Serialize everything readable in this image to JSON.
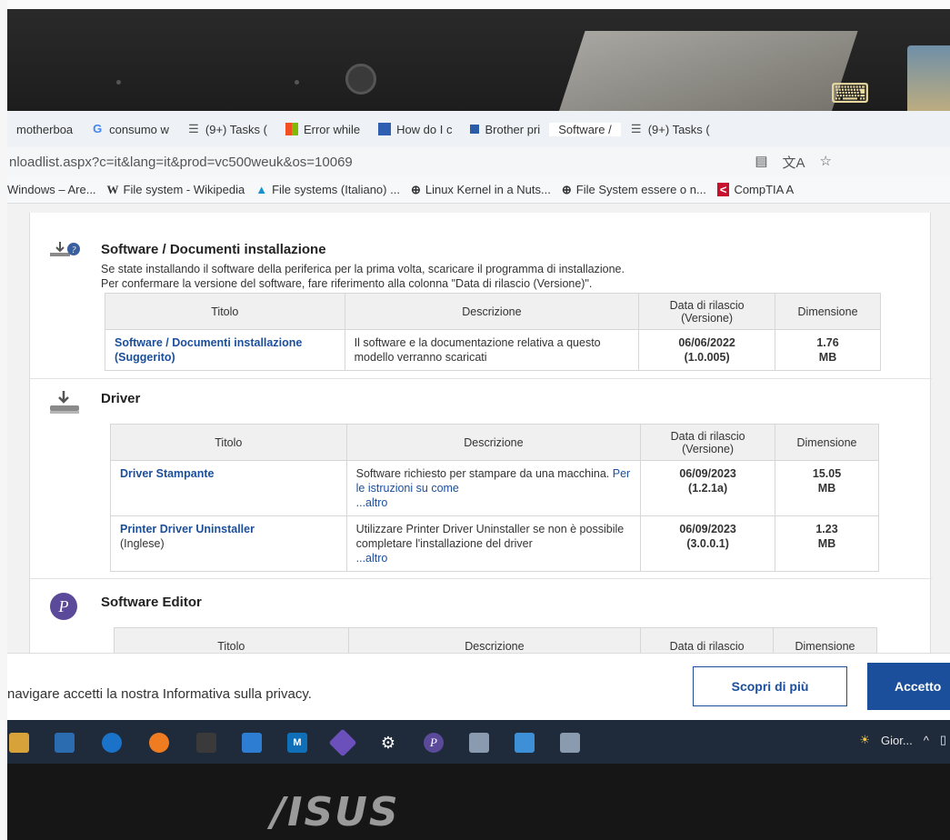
{
  "browser": {
    "tabs": [
      {
        "label": "motherboa",
        "icon": "page-icon"
      },
      {
        "label": "consumo w",
        "icon": "google-icon"
      },
      {
        "label": "(9+) Tasks (",
        "icon": "tasks-icon"
      },
      {
        "label": "Error while",
        "icon": "windows-icon"
      },
      {
        "label": "How do I c",
        "icon": "site-icon"
      },
      {
        "label": "Brother pri",
        "icon": "brother-icon"
      },
      {
        "label": "Software / ",
        "icon": "page-icon"
      },
      {
        "label": "(9+) Tasks (",
        "icon": "tasks-icon"
      }
    ],
    "url": "nloadlist.aspx?c=it&lang=it&prod=vc500weuk&os=10069",
    "bookmarks": [
      {
        "label": "Windows – Are...",
        "icon": ""
      },
      {
        "label": "File system - Wikipedia",
        "icon": "W"
      },
      {
        "label": "File systems (Italiano) ...",
        "icon": "▲"
      },
      {
        "label": "Linux Kernel in a Nuts...",
        "icon": "⊕"
      },
      {
        "label": "File System essere o n...",
        "icon": "⊕"
      },
      {
        "label": "CompTIA A",
        "icon": "<"
      }
    ]
  },
  "sections": {
    "install": {
      "title": "Software / Documenti installazione",
      "desc1": "Se state installando il software della periferica per la prima volta, scaricare il programma di installazione.",
      "desc2": "Per confermare la versione del software, fare riferimento alla colonna \"Data di rilascio (Versione)\".",
      "headers": {
        "title": "Titolo",
        "desc": "Descrizione",
        "date": "Data di rilascio (Versione)",
        "size": "Dimensione"
      },
      "rows": [
        {
          "title": "Software / Documenti installazione (Suggerito)",
          "title_extra": "",
          "desc": "Il software e la documentazione relativa a questo modello verranno scaricati",
          "link": "",
          "more": "",
          "date": "06/06/2022",
          "version": "(1.0.005)",
          "size1": "1.76",
          "size2": "MB"
        }
      ]
    },
    "driver": {
      "title": "Driver",
      "headers": {
        "title": "Titolo",
        "desc": "Descrizione",
        "date": "Data di rilascio (Versione)",
        "size": "Dimensione"
      },
      "rows": [
        {
          "title": "Driver Stampante",
          "title_extra": "",
          "desc": "Software richiesto per stampare da una macchina.",
          "link": "Per le istruzioni su come",
          "more": "...altro",
          "date": "06/09/2023",
          "version": "(1.2.1a)",
          "size1": "15.05",
          "size2": "MB"
        },
        {
          "title": "Printer Driver Uninstaller",
          "title_extra": "(Inglese)",
          "desc": "Utilizzare Printer Driver Uninstaller se non è possibile completare l'installazione del driver",
          "link": "",
          "more": "...altro",
          "date": "06/09/2023",
          "version": "(3.0.0.1)",
          "size1": "1.23",
          "size2": "MB"
        }
      ]
    },
    "editor": {
      "title": "Software Editor",
      "headers": {
        "title": "Titolo",
        "desc": "Descrizione",
        "date": "Data di rilascio",
        "size": "Dimensione"
      }
    }
  },
  "cookie": {
    "text": "navigare accetti la nostra Informativa sulla privacy.",
    "more_label": "Scopri di più",
    "accept_label": "Accetto"
  },
  "taskbar": {
    "weather": "Gior...",
    "caret": "^"
  },
  "laptop": {
    "brand": "/ISUS"
  },
  "colors": {
    "link": "#1b4f9c",
    "accent_button": "#1b4f9c",
    "taskbar": "#1f2a3a"
  }
}
